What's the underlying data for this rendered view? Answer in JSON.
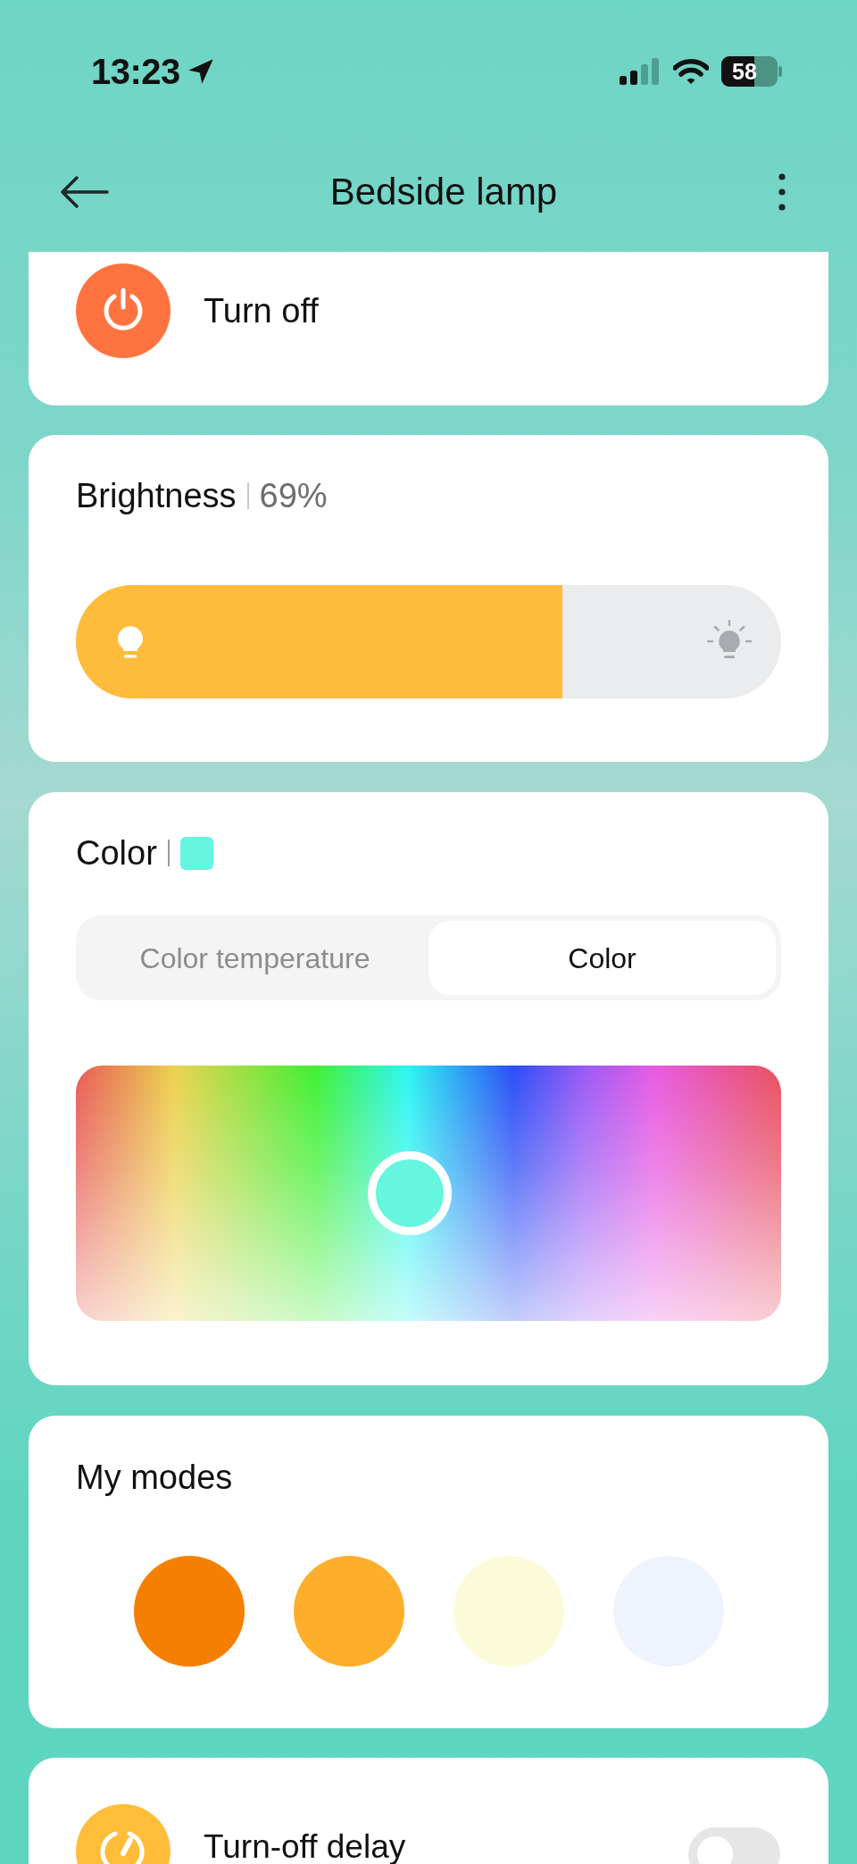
{
  "status_bar": {
    "time": "13:23",
    "battery": "58"
  },
  "header": {
    "title": "Bedside lamp"
  },
  "power": {
    "label": "Turn off",
    "on": true
  },
  "brightness": {
    "title": "Brightness",
    "reading": "69%",
    "level": 0.69
  },
  "color": {
    "title": "Color",
    "color": "#66f5de",
    "tabs": [
      {
        "label": "Color temperature",
        "selected": false
      },
      {
        "label": "Color",
        "selected": true
      }
    ]
  },
  "modes": {
    "title": "My modes",
    "items": [
      {
        "color": "#f57f00"
      },
      {
        "color": "#fdae2a"
      },
      {
        "color": "#fcfbd9"
      },
      {
        "color": "#eef3fe"
      }
    ]
  },
  "turn_off_delay": {
    "label": "Turn-off delay",
    "on": false
  }
}
